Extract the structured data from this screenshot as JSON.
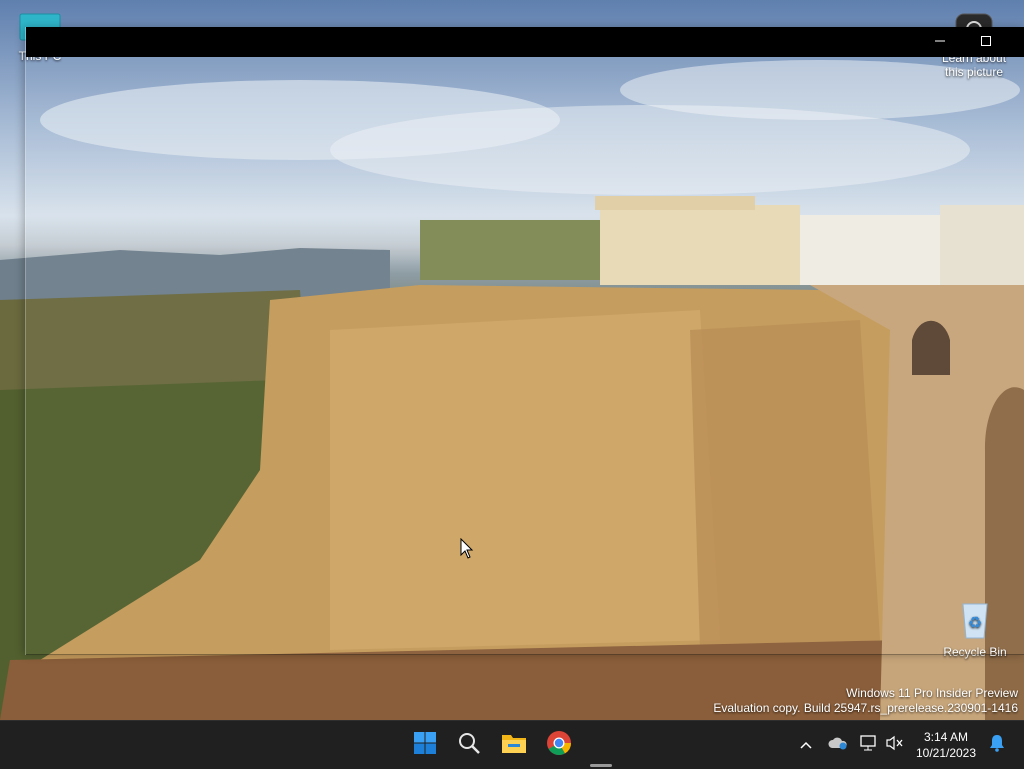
{
  "desktop": {
    "icons": [
      {
        "id": "this-pc",
        "label": "This PC",
        "icon": "monitor-icon"
      },
      {
        "id": "learn",
        "label": "Learn about this picture",
        "icon": "camera-icon"
      },
      {
        "id": "recycle",
        "label": "Recycle Bin",
        "icon": "recycle-bin-icon"
      }
    ]
  },
  "window": {
    "title": "",
    "controls": {
      "minimize": "minimize-icon",
      "maximize": "maximize-icon"
    }
  },
  "watermark": {
    "line1": "Windows 11 Pro Insider Preview",
    "line2": "Evaluation copy. Build 25947.rs_prerelease.230901-1416"
  },
  "taskbar": {
    "apps": [
      {
        "name": "start",
        "icon": "windows-start-icon"
      },
      {
        "name": "search",
        "icon": "search-icon"
      },
      {
        "name": "file-explorer",
        "icon": "folder-icon"
      },
      {
        "name": "chrome",
        "icon": "chrome-icon"
      }
    ],
    "tray": [
      "chevron-up-icon",
      "onedrive-icon",
      "network-icon",
      "volume-muted-icon"
    ],
    "clock": {
      "time": "3:14 AM",
      "date": "10/21/2023"
    },
    "notifications_icon": "bell-icon"
  },
  "colors": {
    "taskbar": "#202020",
    "titlebar": "#000000",
    "accent": "#0078d4"
  }
}
